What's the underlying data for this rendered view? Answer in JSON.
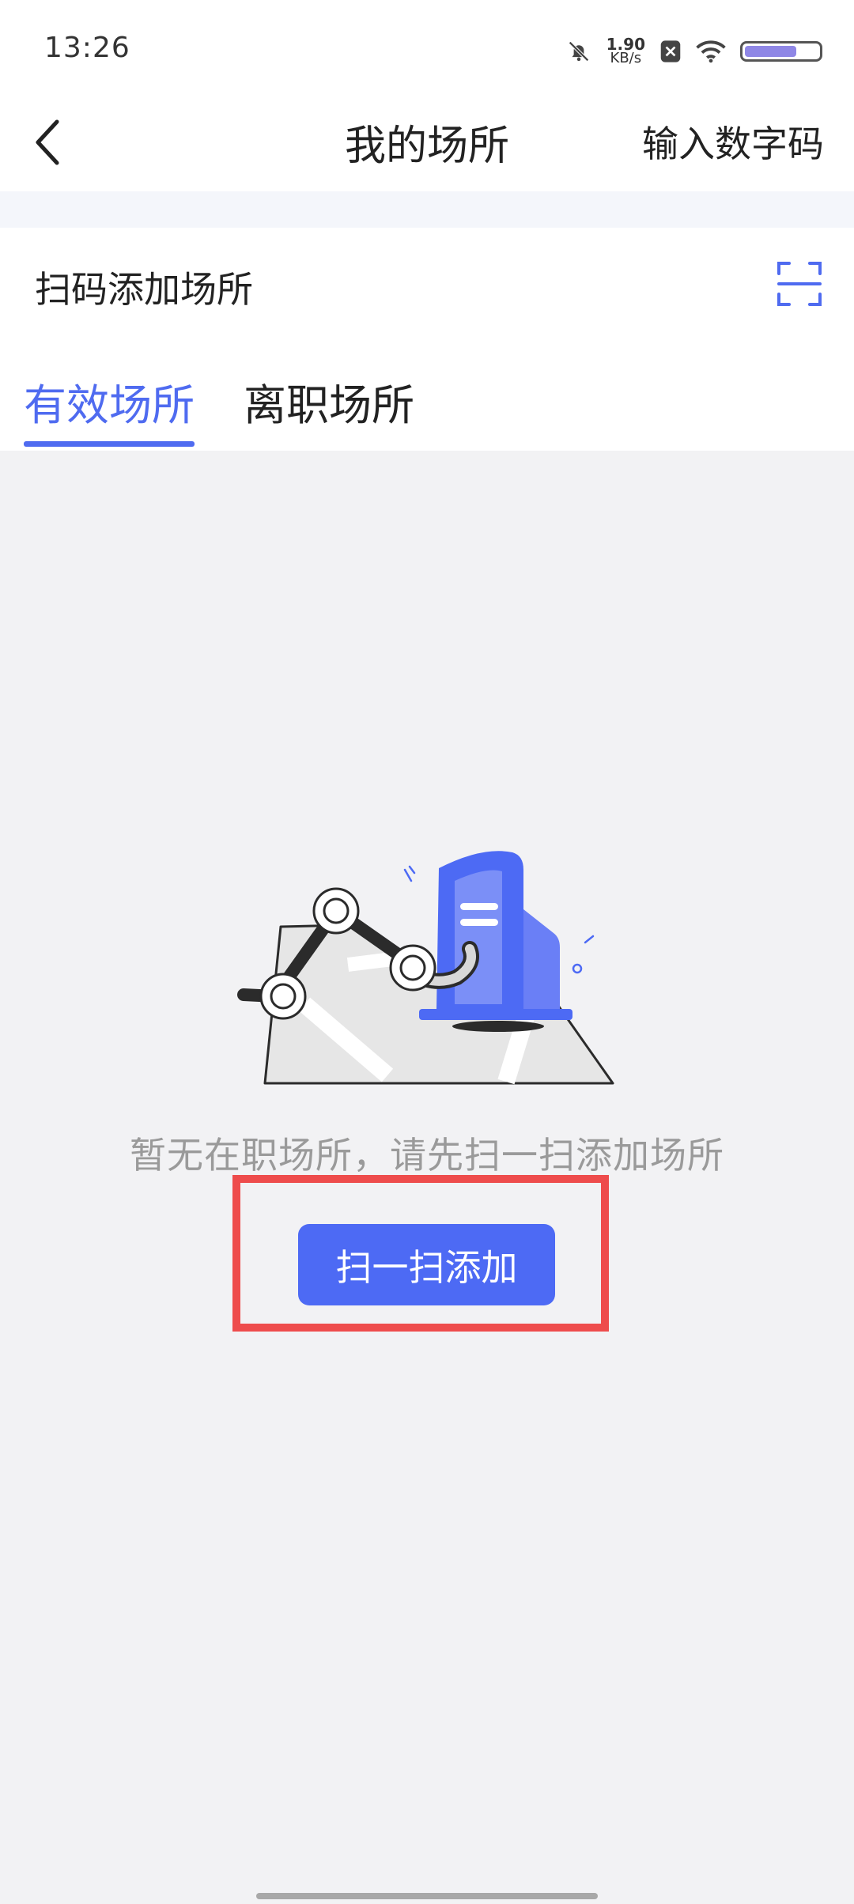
{
  "status_bar": {
    "time": "13:26",
    "net_speed_value": "1.90",
    "net_speed_unit": "KB/s",
    "battery_level": 0.66
  },
  "header": {
    "title": "我的场所",
    "right_action": "输入数字码"
  },
  "scan_row": {
    "label": "扫码添加场所"
  },
  "tabs": [
    {
      "label": "有效场所",
      "active": true
    },
    {
      "label": "离职场所",
      "active": false
    }
  ],
  "empty_state": {
    "message": "暂无在职场所，请先扫一扫添加场所",
    "button_label": "扫一扫添加"
  },
  "colors": {
    "accent": "#4f6bf0",
    "button": "#4d6af4",
    "highlight": "#ee4c4c"
  }
}
